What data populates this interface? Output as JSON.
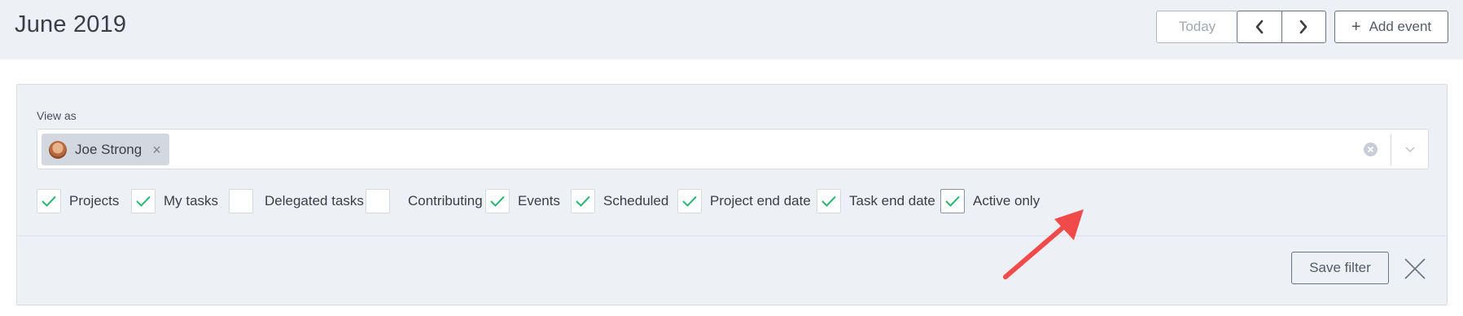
{
  "header": {
    "title": "June 2019",
    "today_label": "Today",
    "add_event_label": "Add event"
  },
  "view_as": {
    "label": "View as",
    "selected_user": "Joe Strong"
  },
  "filters": [
    {
      "label": "Projects",
      "checked": true
    },
    {
      "label": "My tasks",
      "checked": true
    },
    {
      "label": "Delegated tasks",
      "checked": false
    },
    {
      "label": "Contributing",
      "checked": false
    },
    {
      "label": "Events",
      "checked": true
    },
    {
      "label": "Scheduled",
      "checked": true
    },
    {
      "label": "Project end date",
      "checked": true
    },
    {
      "label": "Task end date",
      "checked": true
    },
    {
      "label": "Active only",
      "checked": true
    }
  ],
  "actions": {
    "save_filter_label": "Save filter"
  },
  "colors": {
    "check": "#2bb673",
    "annotation_arrow": "#f04a4a",
    "header_bg": "#edf0f5"
  }
}
